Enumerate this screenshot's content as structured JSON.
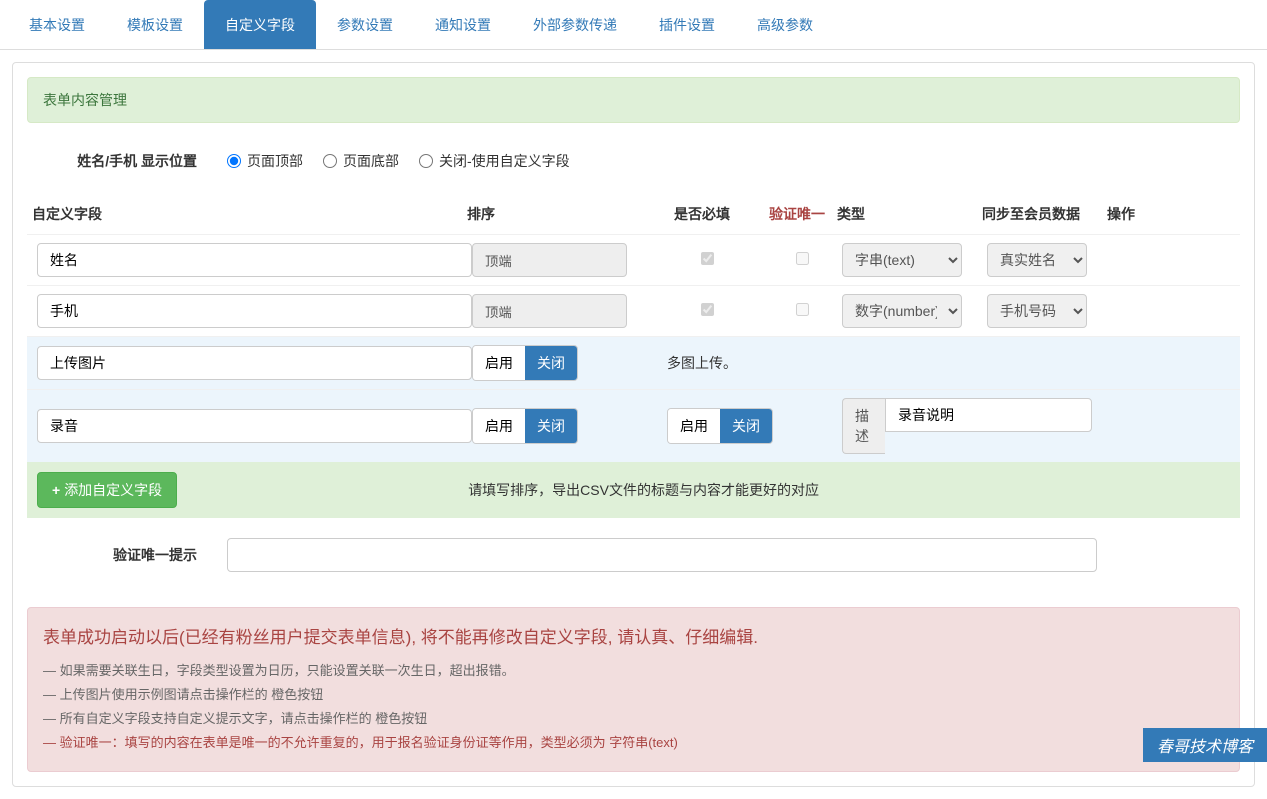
{
  "tabs": [
    "基本设置",
    "模板设置",
    "自定义字段",
    "参数设置",
    "通知设置",
    "外部参数传递",
    "插件设置",
    "高级参数"
  ],
  "activeTab": 2,
  "sectionTitle": "表单内容管理",
  "positionLabel": "姓名/手机 显示位置",
  "positionOptions": [
    "页面顶部",
    "页面底部",
    "关闭-使用自定义字段"
  ],
  "headers": {
    "name": "自定义字段",
    "sort": "排序",
    "required": "是否必填",
    "unique": "验证唯一",
    "type": "类型",
    "sync": "同步至会员数据",
    "action": "操作"
  },
  "rows": {
    "name": {
      "value": "姓名",
      "sort": "顶端",
      "type": "字串(text)",
      "sync": "真实姓名"
    },
    "phone": {
      "value": "手机",
      "sort": "顶端",
      "type": "数字(number)",
      "sync": "手机号码"
    },
    "upload": {
      "value": "上传图片",
      "enable": "启用",
      "disable": "关闭",
      "note": "多图上传。"
    },
    "record": {
      "value": "录音",
      "enable": "启用",
      "disable": "关闭",
      "enable2": "启用",
      "disable2": "关闭",
      "descLabel": "描述",
      "descValue": "录音说明"
    }
  },
  "addButton": "添加自定义字段",
  "addNote": "请填写排序，导出CSV文件的标题与内容才能更好的对应",
  "hintLabel": "验证唯一提示",
  "alert": {
    "title": "表单成功启动以后(已经有粉丝用户提交表单信息), 将不能再修改自定义字段, 请认真、仔细编辑.",
    "lines": [
      "— 如果需要关联生日，字段类型设置为日历，只能设置关联一次生日，超出报错。",
      "— 上传图片使用示例图请点击操作栏的 橙色按钮",
      "— 所有自定义字段支持自定义提示文字，请点击操作栏的 橙色按钮",
      "— 验证唯一：填写的内容在表单是唯一的不允许重复的，用于报名验证身份证等作用，类型必须为 字符串(text)"
    ]
  },
  "watermark": "春哥技术博客"
}
